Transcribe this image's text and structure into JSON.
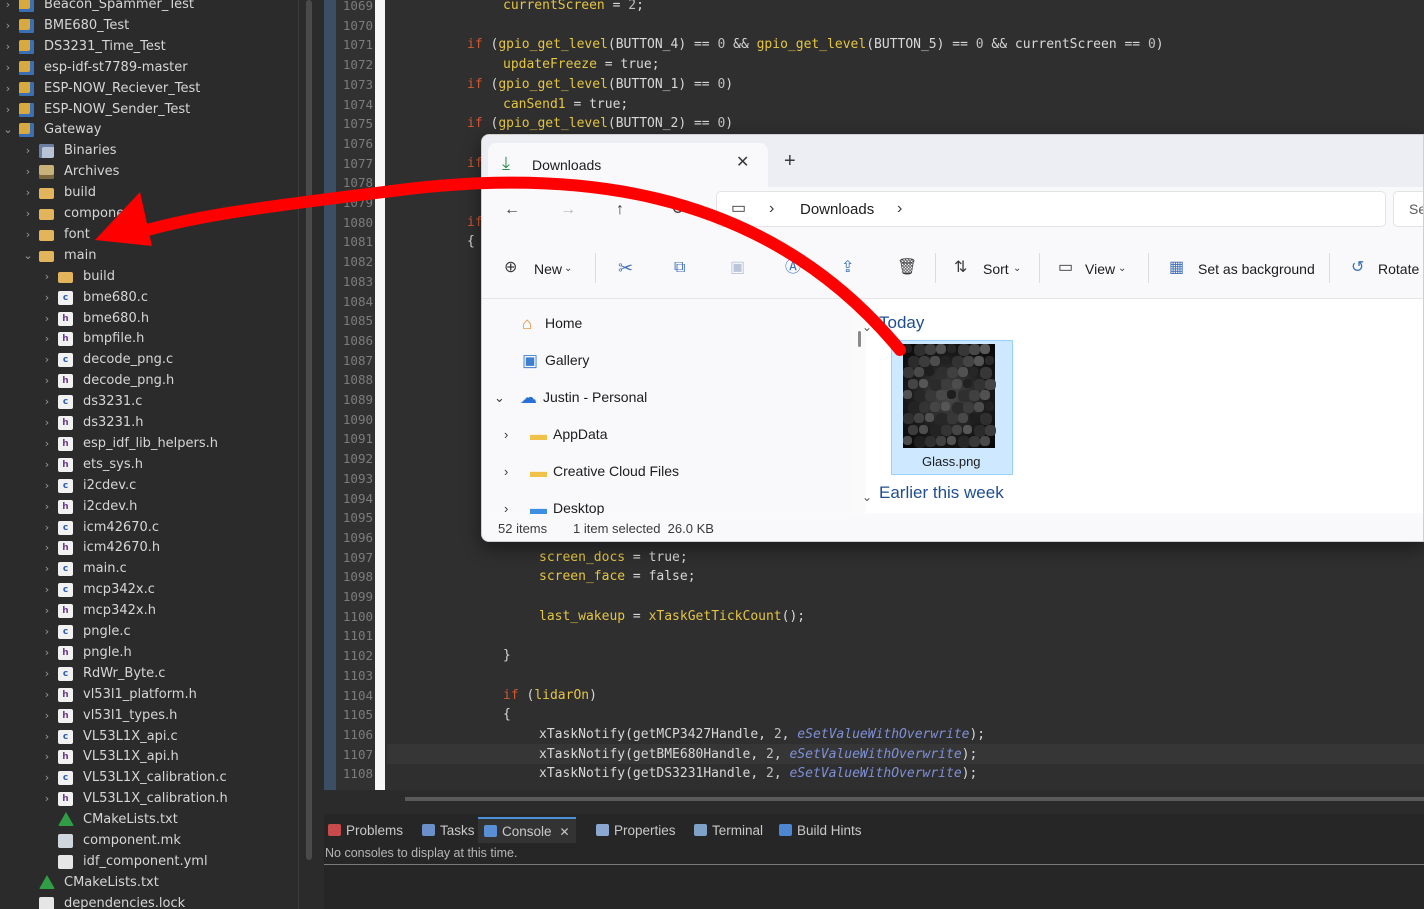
{
  "project_tree": {
    "items": [
      {
        "label": "Beacon_Spammer_Test",
        "icon": "project-icon",
        "chevron": "›",
        "level": 0
      },
      {
        "label": "BME680_Test",
        "icon": "project-icon",
        "chevron": "›",
        "level": 0
      },
      {
        "label": "DS3231_Time_Test",
        "icon": "project-icon",
        "chevron": "›",
        "level": 0
      },
      {
        "label": "esp-idf-st7789-master",
        "icon": "project-icon",
        "chevron": "›",
        "level": 0
      },
      {
        "label": "ESP-NOW_Reciever_Test",
        "icon": "project-icon",
        "chevron": "›",
        "level": 0
      },
      {
        "label": "ESP-NOW_Sender_Test",
        "icon": "project-icon",
        "chevron": "›",
        "level": 0
      },
      {
        "label": "Gateway",
        "icon": "project-icon",
        "chevron": "⌄",
        "level": 0
      },
      {
        "label": "Binaries",
        "icon": "binaries-icon",
        "chevron": "›",
        "level": 1
      },
      {
        "label": "Archives",
        "icon": "archives-icon",
        "chevron": "›",
        "level": 1
      },
      {
        "label": "build",
        "icon": "folder-icon",
        "chevron": "›",
        "level": 1
      },
      {
        "label": "components",
        "icon": "folder-icon",
        "chevron": "›",
        "level": 1
      },
      {
        "label": "font",
        "icon": "folder-icon",
        "chevron": "›",
        "level": 1
      },
      {
        "label": "main",
        "icon": "folder-icon",
        "chevron": "⌄",
        "level": 1
      },
      {
        "label": "build",
        "icon": "folder-icon",
        "chevron": "›",
        "level": 2
      },
      {
        "label": "bme680.c",
        "icon": "c-file-icon",
        "chevron": "›",
        "level": 2
      },
      {
        "label": "bme680.h",
        "icon": "h-file-icon",
        "chevron": "›",
        "level": 2
      },
      {
        "label": "bmpfile.h",
        "icon": "h-file-icon",
        "chevron": "›",
        "level": 2
      },
      {
        "label": "decode_png.c",
        "icon": "c-file-icon",
        "chevron": "›",
        "level": 2
      },
      {
        "label": "decode_png.h",
        "icon": "h-file-icon",
        "chevron": "›",
        "level": 2
      },
      {
        "label": "ds3231.c",
        "icon": "c-file-icon",
        "chevron": "›",
        "level": 2
      },
      {
        "label": "ds3231.h",
        "icon": "h-file-icon",
        "chevron": "›",
        "level": 2
      },
      {
        "label": "esp_idf_lib_helpers.h",
        "icon": "h-file-icon",
        "chevron": "›",
        "level": 2
      },
      {
        "label": "ets_sys.h",
        "icon": "h-file-icon",
        "chevron": "›",
        "level": 2
      },
      {
        "label": "i2cdev.c",
        "icon": "c-file-icon",
        "chevron": "›",
        "level": 2
      },
      {
        "label": "i2cdev.h",
        "icon": "h-file-icon",
        "chevron": "›",
        "level": 2
      },
      {
        "label": "icm42670.c",
        "icon": "c-file-icon",
        "chevron": "›",
        "level": 2
      },
      {
        "label": "icm42670.h",
        "icon": "h-file-icon",
        "chevron": "›",
        "level": 2
      },
      {
        "label": "main.c",
        "icon": "c-file-icon",
        "chevron": "›",
        "level": 2
      },
      {
        "label": "mcp342x.c",
        "icon": "c-file-icon",
        "chevron": "›",
        "level": 2
      },
      {
        "label": "mcp342x.h",
        "icon": "h-file-icon",
        "chevron": "›",
        "level": 2
      },
      {
        "label": "pngle.c",
        "icon": "c-file-icon",
        "chevron": "›",
        "level": 2
      },
      {
        "label": "pngle.h",
        "icon": "h-file-icon",
        "chevron": "›",
        "level": 2
      },
      {
        "label": "RdWr_Byte.c",
        "icon": "c-file-icon",
        "chevron": "›",
        "level": 2
      },
      {
        "label": "vl53l1_platform.h",
        "icon": "h-file-icon",
        "chevron": "›",
        "level": 2
      },
      {
        "label": "vl53l1_types.h",
        "icon": "h-file-icon",
        "chevron": "›",
        "level": 2
      },
      {
        "label": "VL53L1X_api.c",
        "icon": "c-file-icon",
        "chevron": "›",
        "level": 2
      },
      {
        "label": "VL53L1X_api.h",
        "icon": "h-file-icon",
        "chevron": "›",
        "level": 2
      },
      {
        "label": "VL53L1X_calibration.c",
        "icon": "c-file-icon",
        "chevron": "›",
        "level": 2
      },
      {
        "label": "VL53L1X_calibration.h",
        "icon": "h-file-icon",
        "chevron": "›",
        "level": 2
      },
      {
        "label": "CMakeLists.txt",
        "icon": "cmake-icon",
        "chevron": "",
        "level": 2
      },
      {
        "label": "component.mk",
        "icon": "makefile-icon",
        "chevron": "",
        "level": 2
      },
      {
        "label": "idf_component.yml",
        "icon": "yml-file-icon",
        "chevron": "",
        "level": 2
      },
      {
        "label": "CMakeLists.txt",
        "icon": "cmake-icon",
        "chevron": "",
        "level": 1
      },
      {
        "label": "dependencies.lock",
        "icon": "file-icon",
        "chevron": "",
        "level": 1
      }
    ]
  },
  "editor": {
    "line_numbers": [
      "1069",
      "1070",
      "1071",
      "1072",
      "1073",
      "1074",
      "1075",
      "1076",
      "1077",
      "1078",
      "1079",
      "1080",
      "1081",
      "1082",
      "1083",
      "1084",
      "1085",
      "1086",
      "1087",
      "1088",
      "1089",
      "1090",
      "1091",
      "1092",
      "1093",
      "1094",
      "1095",
      "1096",
      "1097",
      "1098",
      "1099",
      "1100",
      "1101",
      "1102",
      "1103",
      "1104",
      "1105",
      "1106",
      "1107",
      "1108"
    ],
    "top_lines": [
      {
        "n": 0,
        "indent": 116,
        "tokens": [
          [
            "var",
            "currentScreen"
          ],
          [
            "op",
            " = "
          ],
          [
            "num",
            "2"
          ],
          [
            "op",
            ";"
          ]
        ]
      },
      {
        "n": 2,
        "indent": 80,
        "tokens": [
          [
            "kw",
            "if"
          ],
          [
            "op",
            " ("
          ],
          [
            "fn",
            "gpio_get_level"
          ],
          [
            "op",
            "(BUTTON_4) "
          ],
          [
            "op",
            "== "
          ],
          [
            "num",
            "0"
          ],
          [
            "op",
            " && "
          ],
          [
            "fn",
            "gpio_get_level"
          ],
          [
            "op",
            "(BUTTON_5) == "
          ],
          [
            "num",
            "0"
          ],
          [
            "op",
            " && currentScreen == "
          ],
          [
            "num",
            "0"
          ],
          [
            "op",
            ")"
          ]
        ]
      },
      {
        "n": 3,
        "indent": 116,
        "tokens": [
          [
            "var",
            "updateFreeze"
          ],
          [
            "op",
            " = true;"
          ]
        ]
      },
      {
        "n": 4,
        "indent": 80,
        "tokens": [
          [
            "kw",
            "if"
          ],
          [
            "op",
            " ("
          ],
          [
            "fn",
            "gpio_get_level"
          ],
          [
            "op",
            "(BUTTON_1) == "
          ],
          [
            "num",
            "0"
          ],
          [
            "op",
            ")"
          ]
        ]
      },
      {
        "n": 5,
        "indent": 116,
        "tokens": [
          [
            "var",
            "canSend1"
          ],
          [
            "op",
            " = true;"
          ]
        ]
      },
      {
        "n": 6,
        "indent": 80,
        "tokens": [
          [
            "kw",
            "if"
          ],
          [
            "op",
            " ("
          ],
          [
            "fn",
            "gpio_get_level"
          ],
          [
            "op",
            "(BUTTON_2) == "
          ],
          [
            "num",
            "0"
          ],
          [
            "op",
            ")"
          ]
        ]
      },
      {
        "n": 8,
        "indent": 80,
        "tokens": [
          [
            "kw",
            "if"
          ]
        ]
      },
      {
        "n": 11,
        "indent": 80,
        "tokens": [
          [
            "kw",
            "if"
          ]
        ]
      },
      {
        "n": 12,
        "indent": 80,
        "tokens": [
          [
            "op",
            "{"
          ]
        ]
      }
    ],
    "bottom_lines": [
      {
        "n": 28,
        "indent": 152,
        "tokens": [
          [
            "var",
            "screen_docs"
          ],
          [
            "op",
            " = true;"
          ]
        ]
      },
      {
        "n": 29,
        "indent": 152,
        "tokens": [
          [
            "var",
            "screen_face"
          ],
          [
            "op",
            " = false;"
          ]
        ]
      },
      {
        "n": 31,
        "indent": 152,
        "tokens": [
          [
            "var",
            "last_wakeup"
          ],
          [
            "op",
            " = "
          ],
          [
            "fn",
            "xTaskGetTickCount"
          ],
          [
            "op",
            "();"
          ]
        ]
      },
      {
        "n": 33,
        "indent": 116,
        "tokens": [
          [
            "op",
            "}"
          ]
        ]
      },
      {
        "n": 35,
        "indent": 116,
        "tokens": [
          [
            "kw",
            "if"
          ],
          [
            "op",
            " ("
          ],
          [
            "var",
            "lidarOn"
          ],
          [
            "op",
            ")"
          ]
        ]
      },
      {
        "n": 36,
        "indent": 116,
        "tokens": [
          [
            "op",
            "{"
          ]
        ]
      },
      {
        "n": 37,
        "indent": 152,
        "tokens": [
          [
            "op",
            "xTaskNotify(getMCP3427Handle, "
          ],
          [
            "num",
            "2"
          ],
          [
            "op",
            ", "
          ],
          [
            "en",
            "eSetValueWithOverwrite"
          ],
          [
            "op",
            ");"
          ]
        ]
      },
      {
        "n": 38,
        "indent": 152,
        "tokens": [
          [
            "op",
            "xTaskNotify(getBME680Handle, "
          ],
          [
            "num",
            "2"
          ],
          [
            "op",
            ", "
          ],
          [
            "en",
            "eSetValueWithOverwrite"
          ],
          [
            "op",
            ");"
          ]
        ]
      },
      {
        "n": 39,
        "indent": 152,
        "tokens": [
          [
            "op",
            "xTaskNotify(getDS3231Handle, "
          ],
          [
            "num",
            "2"
          ],
          [
            "op",
            ", "
          ],
          [
            "en",
            "eSetValueWithOverwrite"
          ],
          [
            "op",
            ");"
          ]
        ]
      }
    ]
  },
  "console": {
    "tabs": [
      {
        "label": "Problems",
        "icon": "problems-icon",
        "color": "#c94a4a"
      },
      {
        "label": "Tasks",
        "icon": "tasks-icon",
        "color": "#6b8fc9"
      },
      {
        "label": "Console",
        "icon": "console-icon",
        "color": "#5a8fd6",
        "active": true,
        "close": "✕"
      },
      {
        "label": "Properties",
        "icon": "properties-icon",
        "color": "#8ca7cf"
      },
      {
        "label": "Terminal",
        "icon": "terminal-icon",
        "color": "#7fa1c8"
      },
      {
        "label": "Build Hints",
        "icon": "build-hints-icon",
        "color": "#4d86d1"
      }
    ],
    "message": "No consoles to display at this time."
  },
  "explorer": {
    "tab_title": "Downloads",
    "tab_close": "✕",
    "new_tab": "+",
    "breadcrumb": [
      "Downloads"
    ],
    "breadcrumb_sep": "›",
    "search_placeholder": "Se",
    "toolbar": {
      "new_label": "New",
      "sort_label": "Sort",
      "view_label": "View",
      "set_background_label": "Set as background",
      "rotate_label": "Rotate l"
    },
    "nav": [
      {
        "label": "Home",
        "icon": "home-icon"
      },
      {
        "label": "Gallery",
        "icon": "gallery-icon"
      },
      {
        "label": "Justin - Personal",
        "icon": "onedrive-icon",
        "chevron": "⌄"
      },
      {
        "label": "AppData",
        "icon": "folder-icon",
        "chevron": "›"
      },
      {
        "label": "Creative Cloud Files",
        "icon": "folder-icon",
        "chevron": "›"
      },
      {
        "label": "Desktop",
        "icon": "desktop-icon",
        "chevron": "›"
      }
    ],
    "groups": {
      "today": "Today",
      "earlier": "Earlier this week"
    },
    "selected_file": {
      "name": "Glass.png"
    },
    "status": {
      "count": "52 items",
      "selection": "1 item selected  26.0 KB"
    }
  },
  "annotation": {
    "arrow_color": "#ff0000"
  }
}
